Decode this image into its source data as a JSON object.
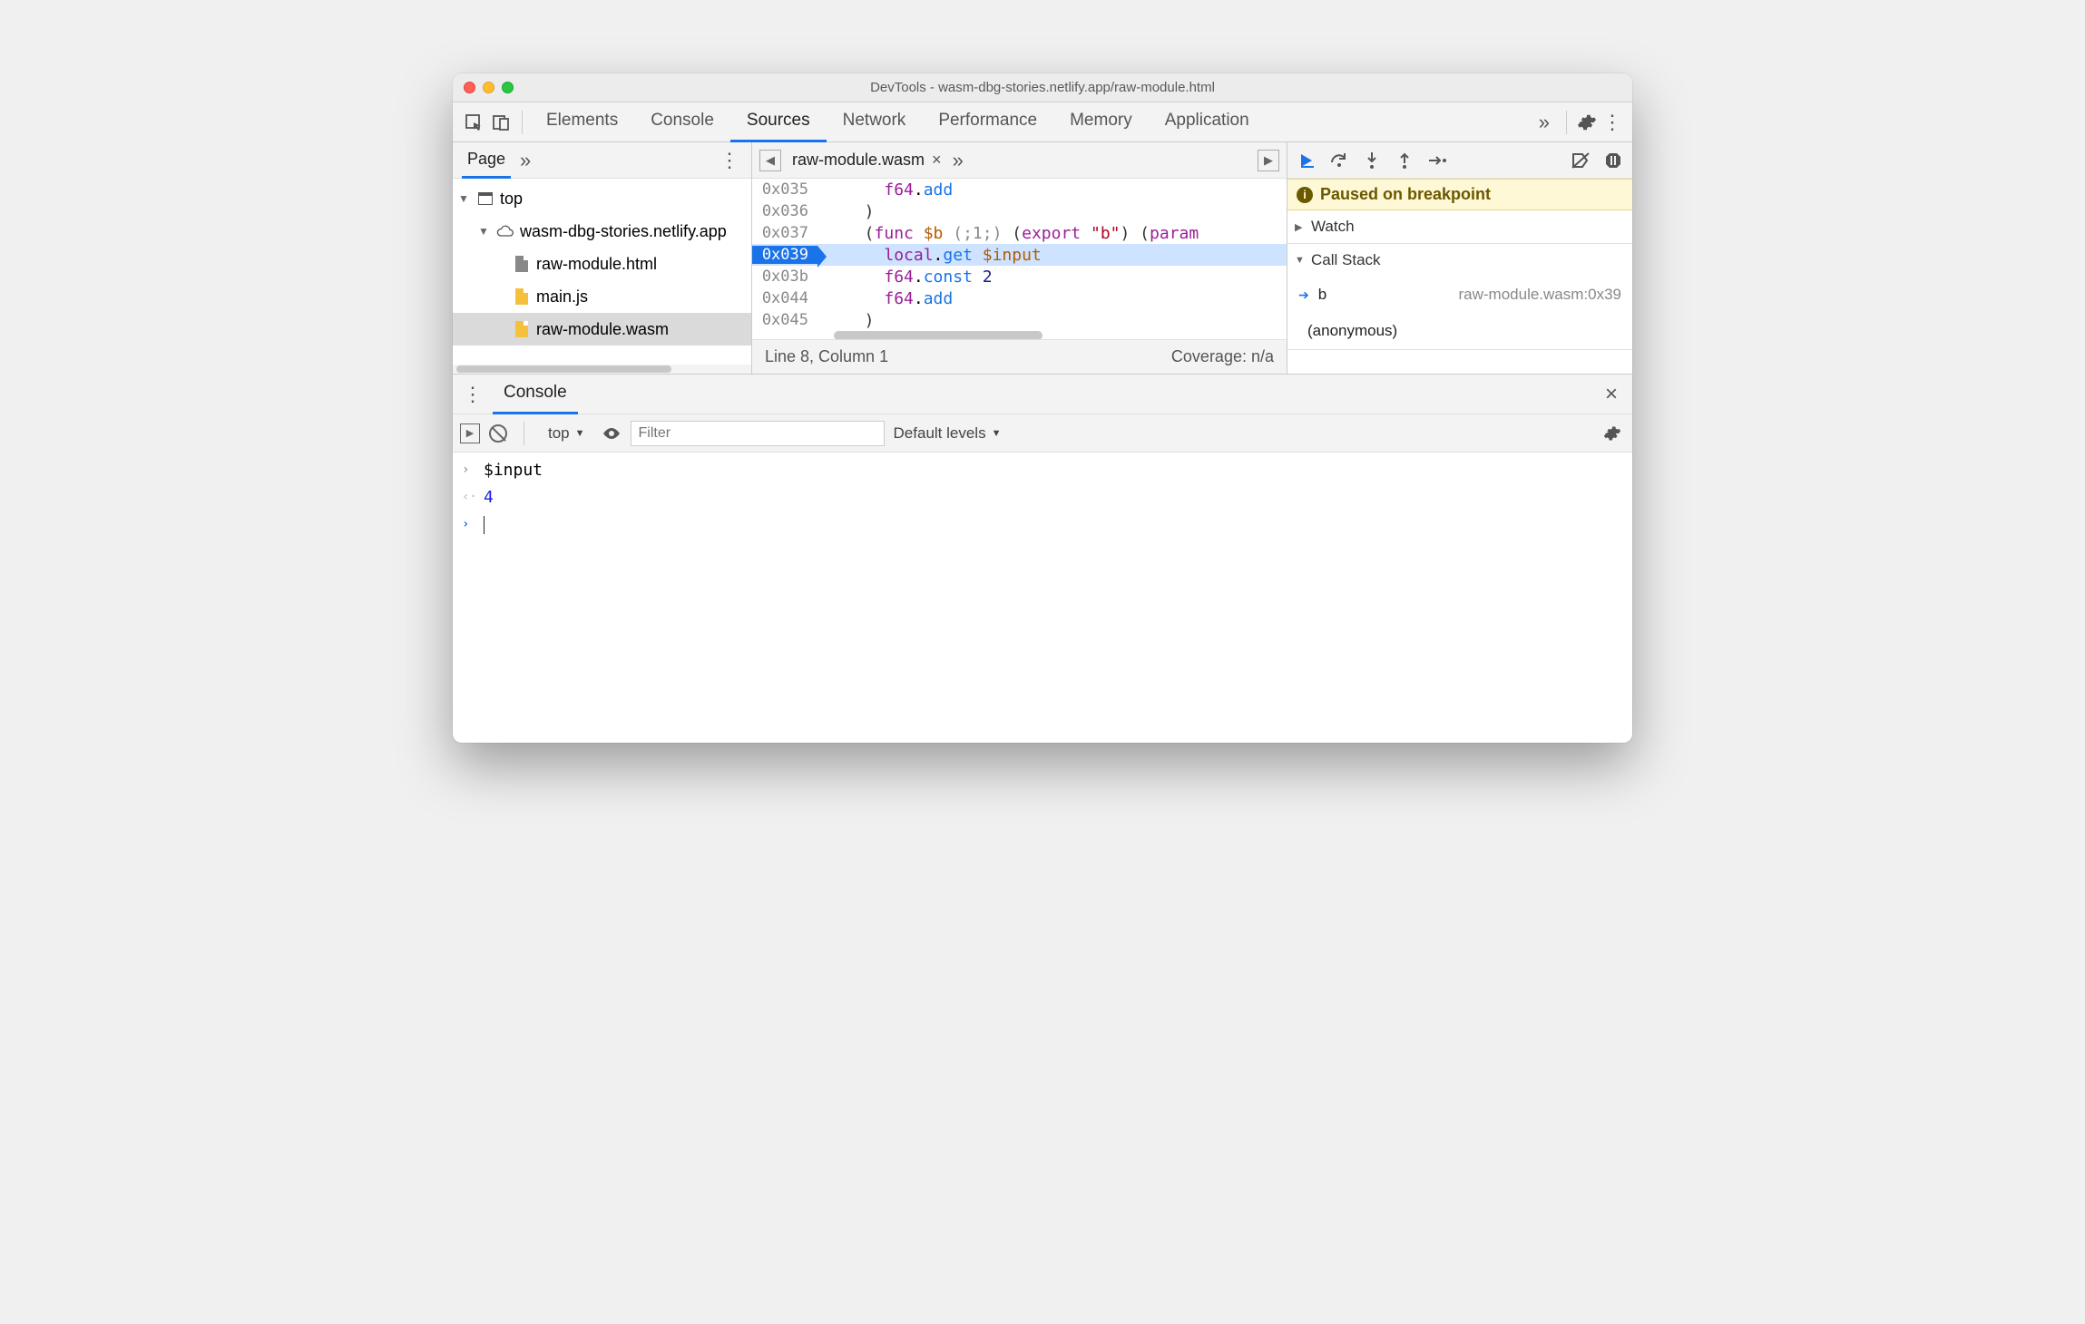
{
  "window": {
    "title": "DevTools - wasm-dbg-stories.netlify.app/raw-module.html"
  },
  "tabs": {
    "items": [
      "Elements",
      "Console",
      "Sources",
      "Network",
      "Performance",
      "Memory",
      "Application"
    ],
    "active": "Sources"
  },
  "sidebar": {
    "page_label": "Page",
    "tree": {
      "top": "top",
      "domain": "wasm-dbg-stories.netlify.app",
      "files": [
        "raw-module.html",
        "main.js",
        "raw-module.wasm"
      ],
      "selected": "raw-module.wasm"
    }
  },
  "editor": {
    "filename": "raw-module.wasm",
    "lines": [
      {
        "addr": "0x035",
        "isBp": false,
        "hl": false,
        "tokens": [
          [
            "    ",
            ""
          ],
          [
            "f64",
            "kw"
          ],
          [
            ".",
            ""
          ],
          [
            "add",
            "fn"
          ]
        ]
      },
      {
        "addr": "0x036",
        "isBp": false,
        "hl": false,
        "tokens": [
          [
            "  )",
            "paren"
          ]
        ]
      },
      {
        "addr": "0x037",
        "isBp": false,
        "hl": false,
        "tokens": [
          [
            "  (",
            "paren"
          ],
          [
            "func",
            "kw"
          ],
          [
            " $b ",
            "var"
          ],
          [
            "(;1;)",
            "comment"
          ],
          [
            " (",
            "paren"
          ],
          [
            "export",
            "kw"
          ],
          [
            " ",
            ""
          ],
          [
            "\"b\"",
            "str"
          ],
          [
            ")",
            "paren"
          ],
          [
            " (",
            "paren"
          ],
          [
            "param",
            "kw"
          ]
        ]
      },
      {
        "addr": "0x039",
        "isBp": true,
        "hl": true,
        "tokens": [
          [
            "    ",
            ""
          ],
          [
            "local",
            "kw"
          ],
          [
            ".",
            ""
          ],
          [
            "get",
            "fn"
          ],
          [
            " $input",
            "var"
          ]
        ]
      },
      {
        "addr": "0x03b",
        "isBp": false,
        "hl": false,
        "tokens": [
          [
            "    ",
            ""
          ],
          [
            "f64",
            "kw"
          ],
          [
            ".",
            ""
          ],
          [
            "const",
            "fn"
          ],
          [
            " ",
            ""
          ],
          [
            "2",
            "num"
          ]
        ]
      },
      {
        "addr": "0x044",
        "isBp": false,
        "hl": false,
        "tokens": [
          [
            "    ",
            ""
          ],
          [
            "f64",
            "kw"
          ],
          [
            ".",
            ""
          ],
          [
            "add",
            "fn"
          ]
        ]
      },
      {
        "addr": "0x045",
        "isBp": false,
        "hl": false,
        "tokens": [
          [
            "  )",
            "paren"
          ]
        ]
      }
    ],
    "status": {
      "position": "Line 8, Column 1",
      "coverage": "Coverage: n/a"
    }
  },
  "debugger": {
    "paused": "Paused on breakpoint",
    "watch": "Watch",
    "callstack_label": "Call Stack",
    "callstack": [
      {
        "name": "b",
        "loc": "raw-module.wasm:0x39",
        "current": true
      },
      {
        "name": "(anonymous)",
        "loc": "",
        "current": false
      }
    ]
  },
  "console": {
    "tab": "Console",
    "context": "top",
    "filter_placeholder": "Filter",
    "levels": "Default levels",
    "entries": [
      {
        "kind": "input",
        "text": "$input"
      },
      {
        "kind": "output",
        "text": "4"
      }
    ]
  }
}
